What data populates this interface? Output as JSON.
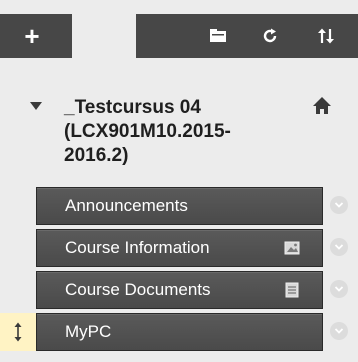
{
  "toolbar": {
    "add_label": "+",
    "icons": [
      "folder-icon",
      "refresh-icon",
      "sort-icon"
    ]
  },
  "course": {
    "title": "_Testcursus 04\n(LCX901M10.2015-\n2016.2)",
    "icon": "home-icon"
  },
  "menu": {
    "items": [
      {
        "label": "Announcements",
        "icon": null
      },
      {
        "label": "Course Information",
        "icon": "image-icon"
      },
      {
        "label": "Course Documents",
        "icon": "document-icon"
      },
      {
        "label": "MyPC",
        "icon": null,
        "drag_handle": "vertical-resize-icon"
      }
    ]
  },
  "colors": {
    "toolbar_bg": "#474747",
    "menu_item_bg": "#4f4f4f",
    "active_handle_bg": "#fff3c4",
    "page_bg": "#ececec"
  }
}
